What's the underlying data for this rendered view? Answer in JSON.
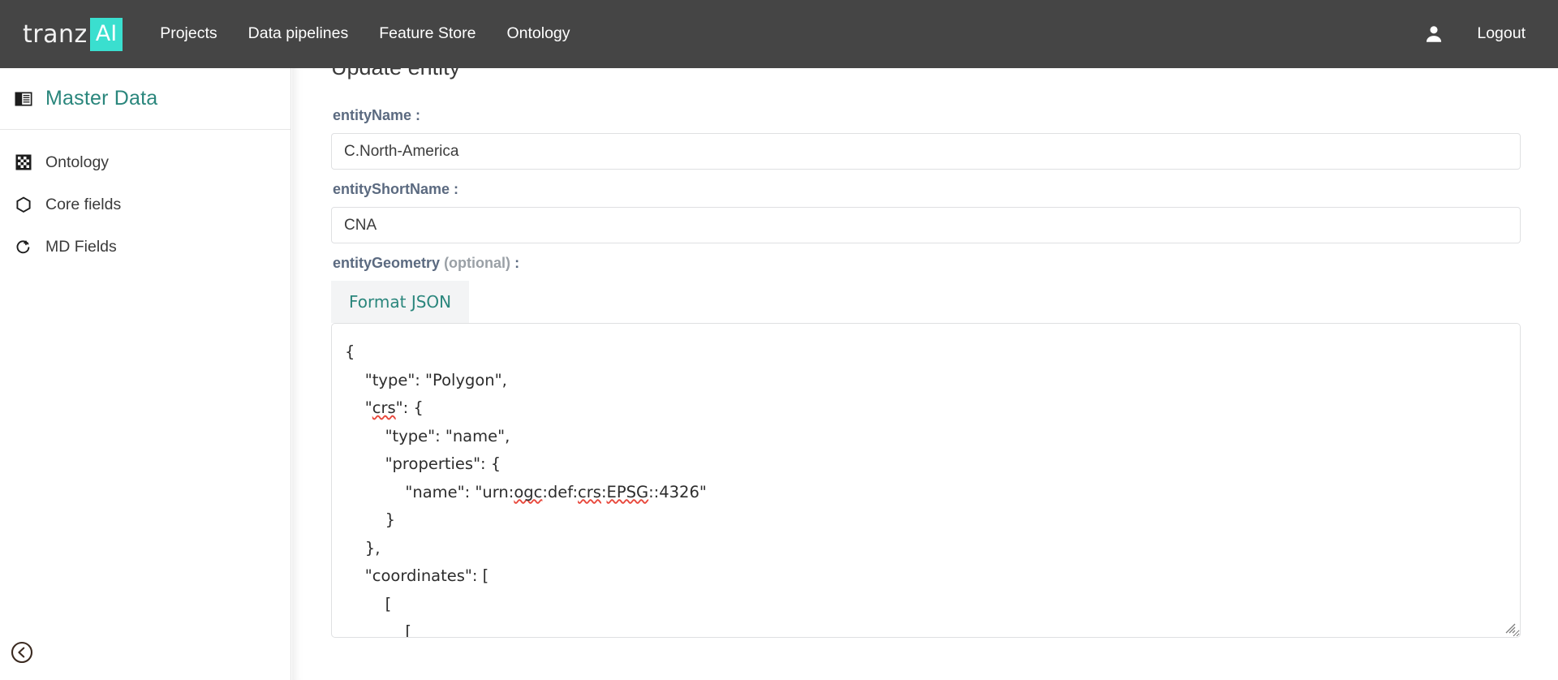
{
  "topnav": {
    "brand": {
      "word": "tranz",
      "badge": "AI",
      "badge_color": "#3ADFCF"
    },
    "links": [
      {
        "label": "Projects",
        "name": "nav-link-projects"
      },
      {
        "label": "Data pipelines",
        "name": "nav-link-data-pipelines"
      },
      {
        "label": "Feature Store",
        "name": "nav-link-feature-store"
      },
      {
        "label": "Ontology",
        "name": "nav-link-ontology"
      }
    ],
    "account_icon": "user-icon",
    "logout_label": "Logout",
    "background_color": "#454545"
  },
  "sidebar": {
    "title": "Master Data",
    "title_color": "#2A867C",
    "title_icon": "book-icon",
    "items": [
      {
        "label": "Ontology",
        "icon": "checkerboard-icon"
      },
      {
        "label": "Core fields",
        "icon": "hexagon-icon"
      },
      {
        "label": "MD Fields",
        "icon": "refresh-icon"
      }
    ],
    "collapse_icon": "chevron-left-circle-icon"
  },
  "main": {
    "heading": "Update entity",
    "fields": {
      "entity_name": {
        "label": "entityName :",
        "value": "C.North-America",
        "placeholder": ""
      },
      "entity_short_name": {
        "label": "entityShortName :",
        "value": "CNA",
        "placeholder": ""
      },
      "entity_geometry": {
        "label_main": "entityGeometry",
        "label_optional": "(optional)",
        "label_colon": ":",
        "format_button": "Format JSON",
        "json_lines": [
          {
            "text": "{",
            "misspelled": []
          },
          {
            "text": "    \"type\": \"Polygon\",",
            "misspelled": []
          },
          {
            "text": "    \"crs\": {",
            "misspelled": [
              "crs"
            ]
          },
          {
            "text": "        \"type\": \"name\",",
            "misspelled": []
          },
          {
            "text": "        \"properties\": {",
            "misspelled": []
          },
          {
            "text": "            \"name\": \"urn:ogc:def:crs:EPSG::4326\"",
            "misspelled": [
              "ogc",
              "crs",
              "EPSG"
            ]
          },
          {
            "text": "        }",
            "misspelled": []
          },
          {
            "text": "    },",
            "misspelled": []
          },
          {
            "text": "    \"coordinates\": [",
            "misspelled": []
          },
          {
            "text": "        [",
            "misspelled": []
          },
          {
            "text": "            [",
            "misspelled": []
          }
        ],
        "json_value": "{\n    \"type\": \"Polygon\",\n    \"crs\": {\n        \"type\": \"name\",\n        \"properties\": {\n            \"name\": \"urn:ogc:def:crs:EPSG::4326\"\n        }\n    },\n    \"coordinates\": [\n        [\n            [",
        "resize_handle": "resize-grip-icon"
      }
    }
  }
}
